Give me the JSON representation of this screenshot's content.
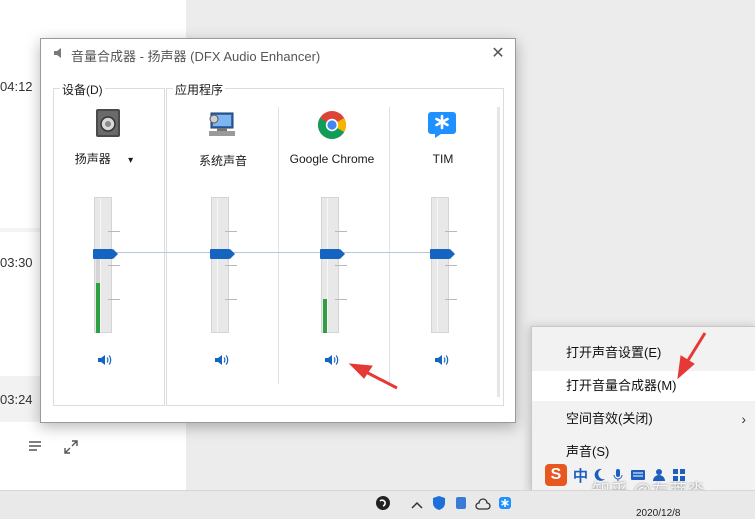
{
  "background": {
    "times": [
      "04:12",
      "03:30",
      "03:24"
    ]
  },
  "window": {
    "title": "音量合成器 - 扬声器 (DFX Audio Enhancer)",
    "close_glyph": "✕"
  },
  "device_group": {
    "title": "设备(D)",
    "device_name": "扬声器",
    "dropdown_glyph": "▾",
    "volume_percent": 58,
    "meter_percent": 37,
    "meter_peak_percent": 60
  },
  "apps_group": {
    "title": "应用程序",
    "apps": [
      {
        "name": "系统声音",
        "icon": "system-sounds-icon",
        "volume_percent": 58,
        "meter_percent": 0
      },
      {
        "name": "Google Chrome",
        "icon": "chrome-icon",
        "volume_percent": 58,
        "meter_percent": 25
      },
      {
        "name": "TIM",
        "icon": "tim-icon",
        "volume_percent": 58,
        "meter_percent": 0
      }
    ]
  },
  "context_menu": {
    "items": [
      {
        "label": "打开声音设置(E)"
      },
      {
        "label": "打开音量合成器(M)"
      },
      {
        "label": "空间音效(关闭)",
        "submenu": true
      },
      {
        "label": "声音(S)"
      }
    ],
    "chevron_glyph": "›"
  },
  "ime": {
    "logo": "S",
    "mode": "中"
  },
  "watermark": "知乎 @左萃淼",
  "taskbar": {
    "date": "2020/12/8"
  },
  "colors": {
    "accent": "#1565c0",
    "meter": "#2ea043",
    "annotation": "#e53935"
  }
}
